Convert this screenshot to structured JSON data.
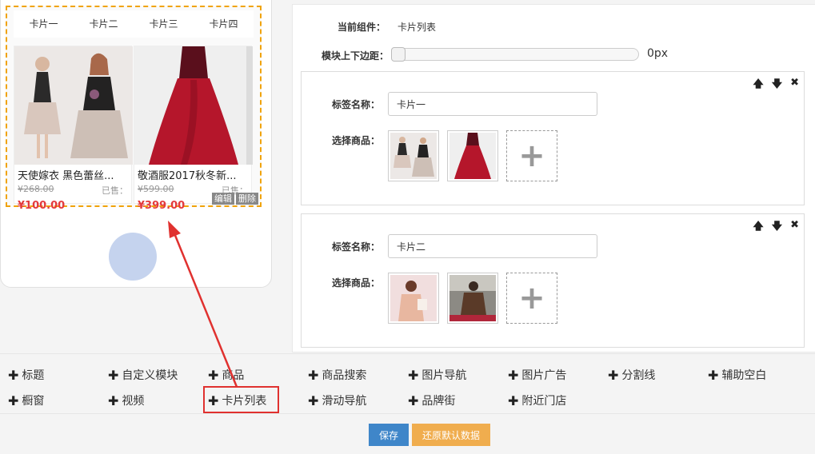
{
  "preview": {
    "tabs": [
      "卡片一",
      "卡片二",
      "卡片三",
      "卡片四"
    ],
    "products": [
      {
        "name": "天使嫁衣 黑色蕾丝...",
        "original_price": "¥268.00",
        "sold_label": "已售：",
        "price": "¥100.00"
      },
      {
        "name": "敬酒服2017秋冬新...",
        "original_price": "¥599.00",
        "sold_label": "已售：",
        "price": "¥399.00"
      }
    ],
    "edit_label": "编辑",
    "delete_label": "删除"
  },
  "panel": {
    "current_component_label": "当前组件：",
    "current_component_value": "卡片列表",
    "margin_label": "模块上下边距：",
    "margin_value": "0px",
    "margin_fraction": 0,
    "cards": [
      {
        "tag_name_label": "标签名称：",
        "tag_name_value": "卡片一",
        "select_goods_label": "选择商品："
      },
      {
        "tag_name_label": "标签名称：",
        "tag_name_value": "卡片二",
        "select_goods_label": "选择商品："
      }
    ],
    "card_controls": {
      "up": "🡅",
      "down": "🡇",
      "remove": "✖"
    },
    "add_icon": "+"
  },
  "components": {
    "row1": [
      "标题",
      "自定义模块",
      "商品",
      "商品搜索",
      "图片导航",
      "图片广告",
      "分割线",
      "辅助空白"
    ],
    "row2": [
      "橱窗",
      "视频",
      "卡片列表",
      "滑动导航",
      "品牌街",
      "附近门店"
    ],
    "plus_icon": "✚"
  },
  "actions": {
    "save": "保存",
    "reset": "还原默认数据"
  },
  "colors": {
    "accent_border": "#f0a30a",
    "price_red": "#e4393c",
    "save_blue": "#3f86c9",
    "reset_orange": "#f0ad4e",
    "highlight_red": "#e0312f"
  }
}
